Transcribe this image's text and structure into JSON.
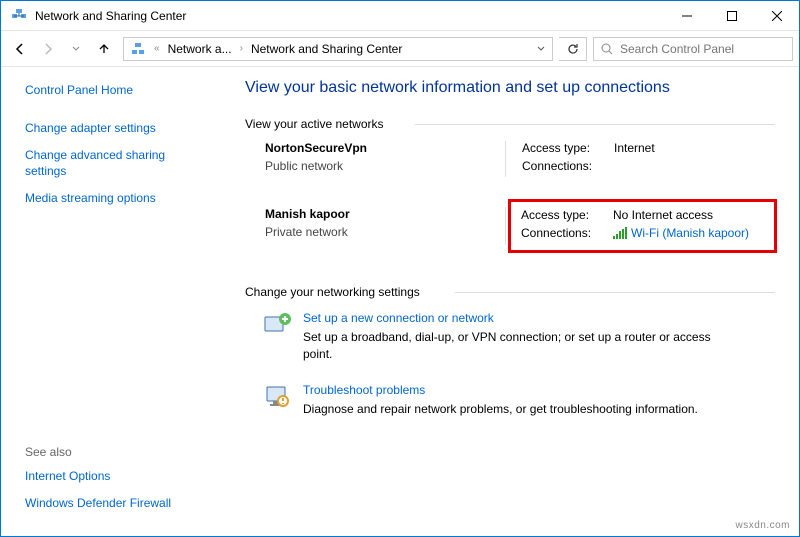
{
  "window": {
    "title": "Network and Sharing Center"
  },
  "breadcrumb": {
    "item1": "Network a...",
    "item2": "Network and Sharing Center"
  },
  "search": {
    "placeholder": "Search Control Panel"
  },
  "sidebar": {
    "home": "Control Panel Home",
    "links": [
      "Change adapter settings",
      "Change advanced sharing settings",
      "Media streaming options"
    ],
    "seealso_label": "See also",
    "seealso": [
      "Internet Options",
      "Windows Defender Firewall"
    ]
  },
  "main": {
    "heading": "View your basic network information and set up connections",
    "active_label": "View your active networks",
    "networks": [
      {
        "name": "NortonSecureVpn",
        "type": "Public network",
        "access_label": "Access type:",
        "access_value": "Internet",
        "conn_label": "Connections:",
        "conn_value": ""
      },
      {
        "name": "Manish kapoor",
        "type": "Private network",
        "access_label": "Access type:",
        "access_value": "No Internet access",
        "conn_label": "Connections:",
        "conn_link": "Wi-Fi (Manish kapoor)"
      }
    ],
    "change_label": "Change your networking settings",
    "settings": [
      {
        "title": "Set up a new connection or network",
        "desc": "Set up a broadband, dial-up, or VPN connection; or set up a router or access point."
      },
      {
        "title": "Troubleshoot problems",
        "desc": "Diagnose and repair network problems, or get troubleshooting information."
      }
    ]
  },
  "watermark": "wsxdn.com"
}
